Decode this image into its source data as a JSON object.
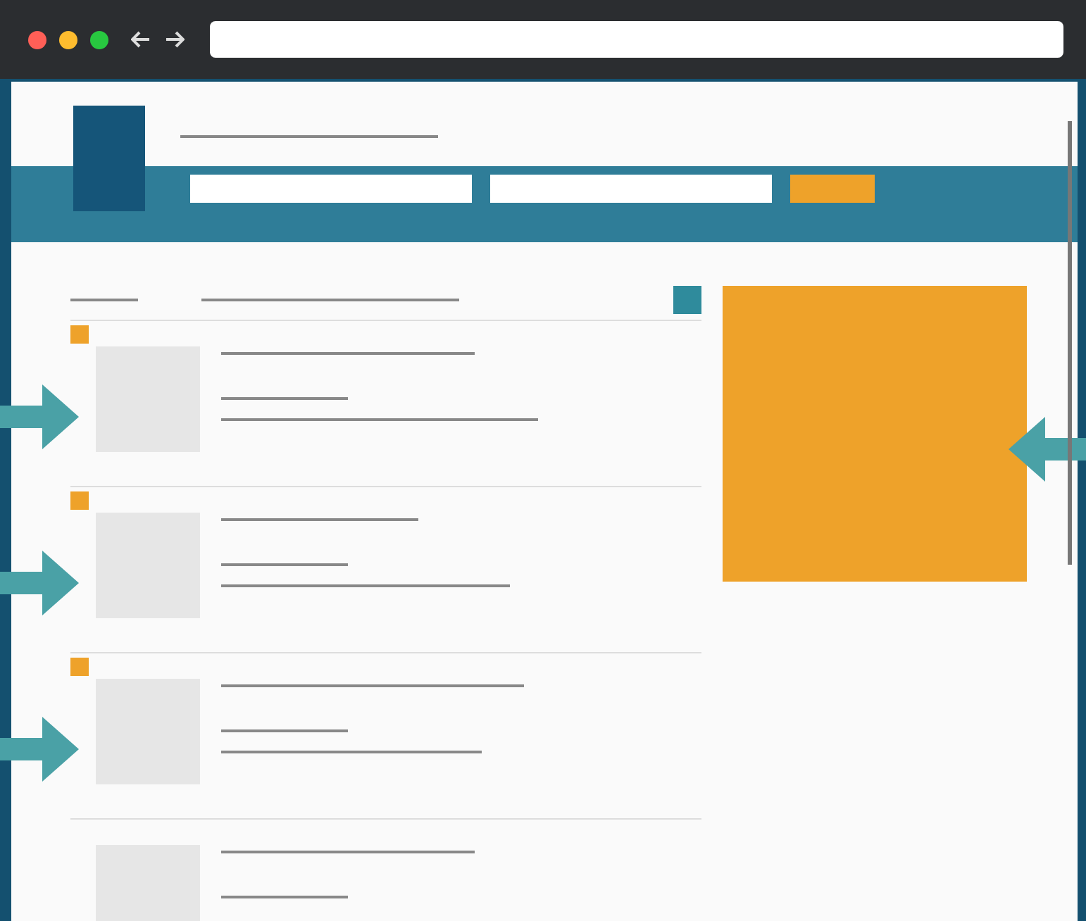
{
  "browser": {
    "traffic_lights": [
      {
        "color": "#ff5f57"
      },
      {
        "color": "#febc2e"
      },
      {
        "color": "#28c840"
      }
    ]
  },
  "listings": [
    {
      "flagged": true,
      "pointed": true
    },
    {
      "flagged": true,
      "pointed": true
    },
    {
      "flagged": true,
      "pointed": true
    },
    {
      "flagged": false,
      "pointed": false
    }
  ],
  "ad": {
    "kind": "banner",
    "pointed": true
  }
}
